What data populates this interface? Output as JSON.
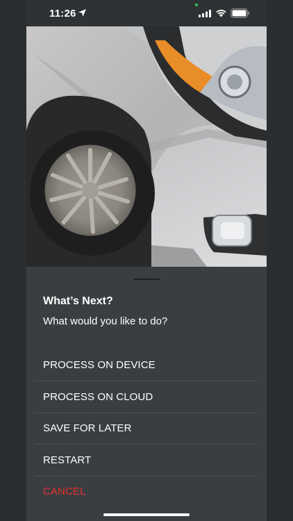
{
  "status_bar": {
    "time": "11:26",
    "icons": [
      "location-arrow-icon",
      "signal-icon",
      "wifi-icon",
      "battery-icon"
    ]
  },
  "photo": {
    "subject": "car-front-wheel-photo"
  },
  "sheet": {
    "title": "What’s Next?",
    "subtitle": "What would you like to do?",
    "options": [
      {
        "label": "PROCESS ON DEVICE",
        "color": "#ffffff"
      },
      {
        "label": "PROCESS ON CLOUD",
        "color": "#ffffff"
      },
      {
        "label": "SAVE FOR LATER",
        "color": "#ffffff"
      },
      {
        "label": "RESTART",
        "color": "#ffffff"
      },
      {
        "label": "CANCEL",
        "color": "#e5302c"
      }
    ]
  },
  "colors": {
    "background": "#2b2e31",
    "sheet": "#3b3e41",
    "cancel": "#e5302c",
    "text": "#ffffff"
  }
}
